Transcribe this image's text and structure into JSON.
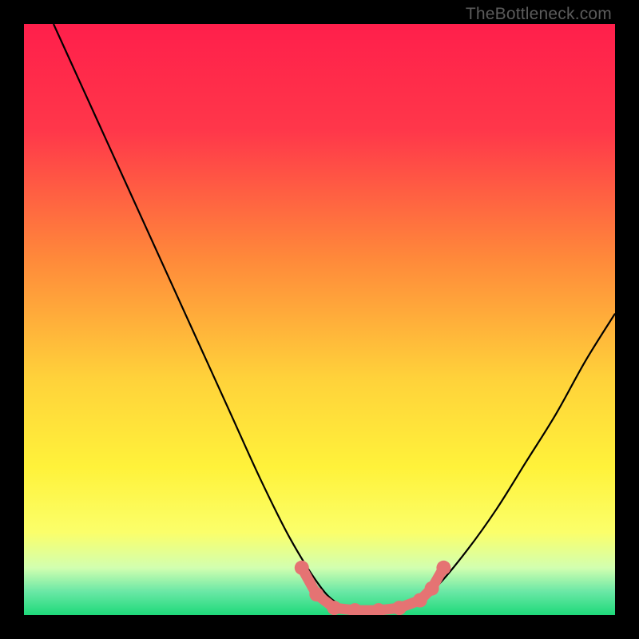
{
  "watermark": "TheBottleneck.com",
  "chart_data": {
    "type": "line",
    "title": "",
    "xlabel": "",
    "ylabel": "",
    "xlim": [
      0,
      100
    ],
    "ylim": [
      0,
      100
    ],
    "grid": false,
    "legend": false,
    "annotations": [],
    "series": [
      {
        "name": "bottleneck-curve",
        "color": "#000000",
        "x": [
          5,
          10,
          15,
          20,
          25,
          30,
          35,
          40,
          45,
          50,
          53,
          56,
          59,
          62,
          66,
          70,
          75,
          80,
          85,
          90,
          95,
          100
        ],
        "y": [
          100,
          89,
          78,
          67,
          56,
          45,
          34,
          23,
          13,
          5,
          2,
          1,
          1,
          1,
          2,
          5,
          11,
          18,
          26,
          34,
          43,
          51
        ]
      }
    ],
    "dip_markers": {
      "name": "dip-markers",
      "color": "#e57373",
      "x": [
        47,
        49.5,
        52.5,
        56,
        60,
        63.5,
        67,
        69,
        71
      ],
      "y": [
        8,
        3.5,
        1.2,
        0.8,
        0.8,
        1.2,
        2.5,
        4.5,
        8
      ]
    },
    "gradient_stops": [
      {
        "pct": 0,
        "color": "#ff1f4b"
      },
      {
        "pct": 18,
        "color": "#ff374a"
      },
      {
        "pct": 40,
        "color": "#ff8a3a"
      },
      {
        "pct": 60,
        "color": "#ffd23a"
      },
      {
        "pct": 75,
        "color": "#fff23a"
      },
      {
        "pct": 86,
        "color": "#fbff6a"
      },
      {
        "pct": 92,
        "color": "#d2ffb0"
      },
      {
        "pct": 96,
        "color": "#6be8a6"
      },
      {
        "pct": 100,
        "color": "#1ed97a"
      }
    ]
  }
}
